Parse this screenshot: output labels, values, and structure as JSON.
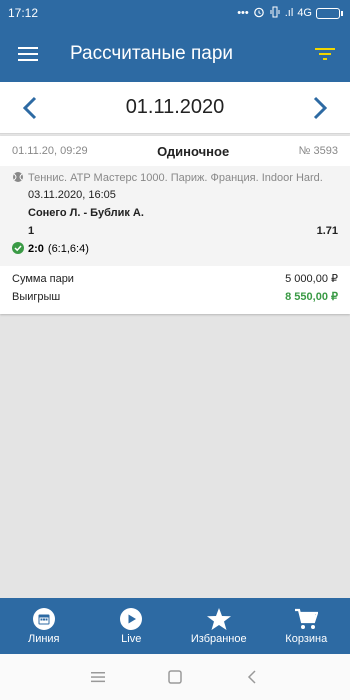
{
  "status_bar": {
    "time": "17:12",
    "icons": [
      "dots-icon",
      "alarm-icon",
      "vibrate-icon",
      "signal-icon",
      "battery-icon"
    ],
    "network": "4G",
    "signal": ".ıl"
  },
  "app_bar": {
    "title": "Рассчитаные пари",
    "menu_icon": "hamburger-menu-icon",
    "filter_icon": "filter-icon"
  },
  "date_nav": {
    "date": "01.11.2020"
  },
  "bet": {
    "created": "01.11.20, 09:29",
    "type": "Одиночное",
    "number": "№ 3593",
    "event": {
      "league": "Теннис. ATP Мастерс 1000. Париж. Франция. Indoor Hard.",
      "datetime": "03.11.2020, 16:05",
      "teams": "Сонего Л. - Бублик А.",
      "pick": "1",
      "odds": "1.71",
      "score": "2:0",
      "score_details": "(6:1,6:4)"
    },
    "stake_label": "Сумма пари",
    "stake_value": "5 000,00 ₽",
    "win_label": "Выигрыш",
    "win_value": "8 550,00 ₽"
  },
  "bottom_nav": {
    "items": [
      {
        "label": "Линия",
        "icon": "calendar-icon"
      },
      {
        "label": "Live",
        "icon": "play-icon"
      },
      {
        "label": "Избранное",
        "icon": "star-icon"
      },
      {
        "label": "Корзина",
        "icon": "cart-icon"
      }
    ]
  },
  "colors": {
    "primary": "#2d6aa3",
    "filter_accent": "#f2d600",
    "win_green": "#3a9a45"
  }
}
